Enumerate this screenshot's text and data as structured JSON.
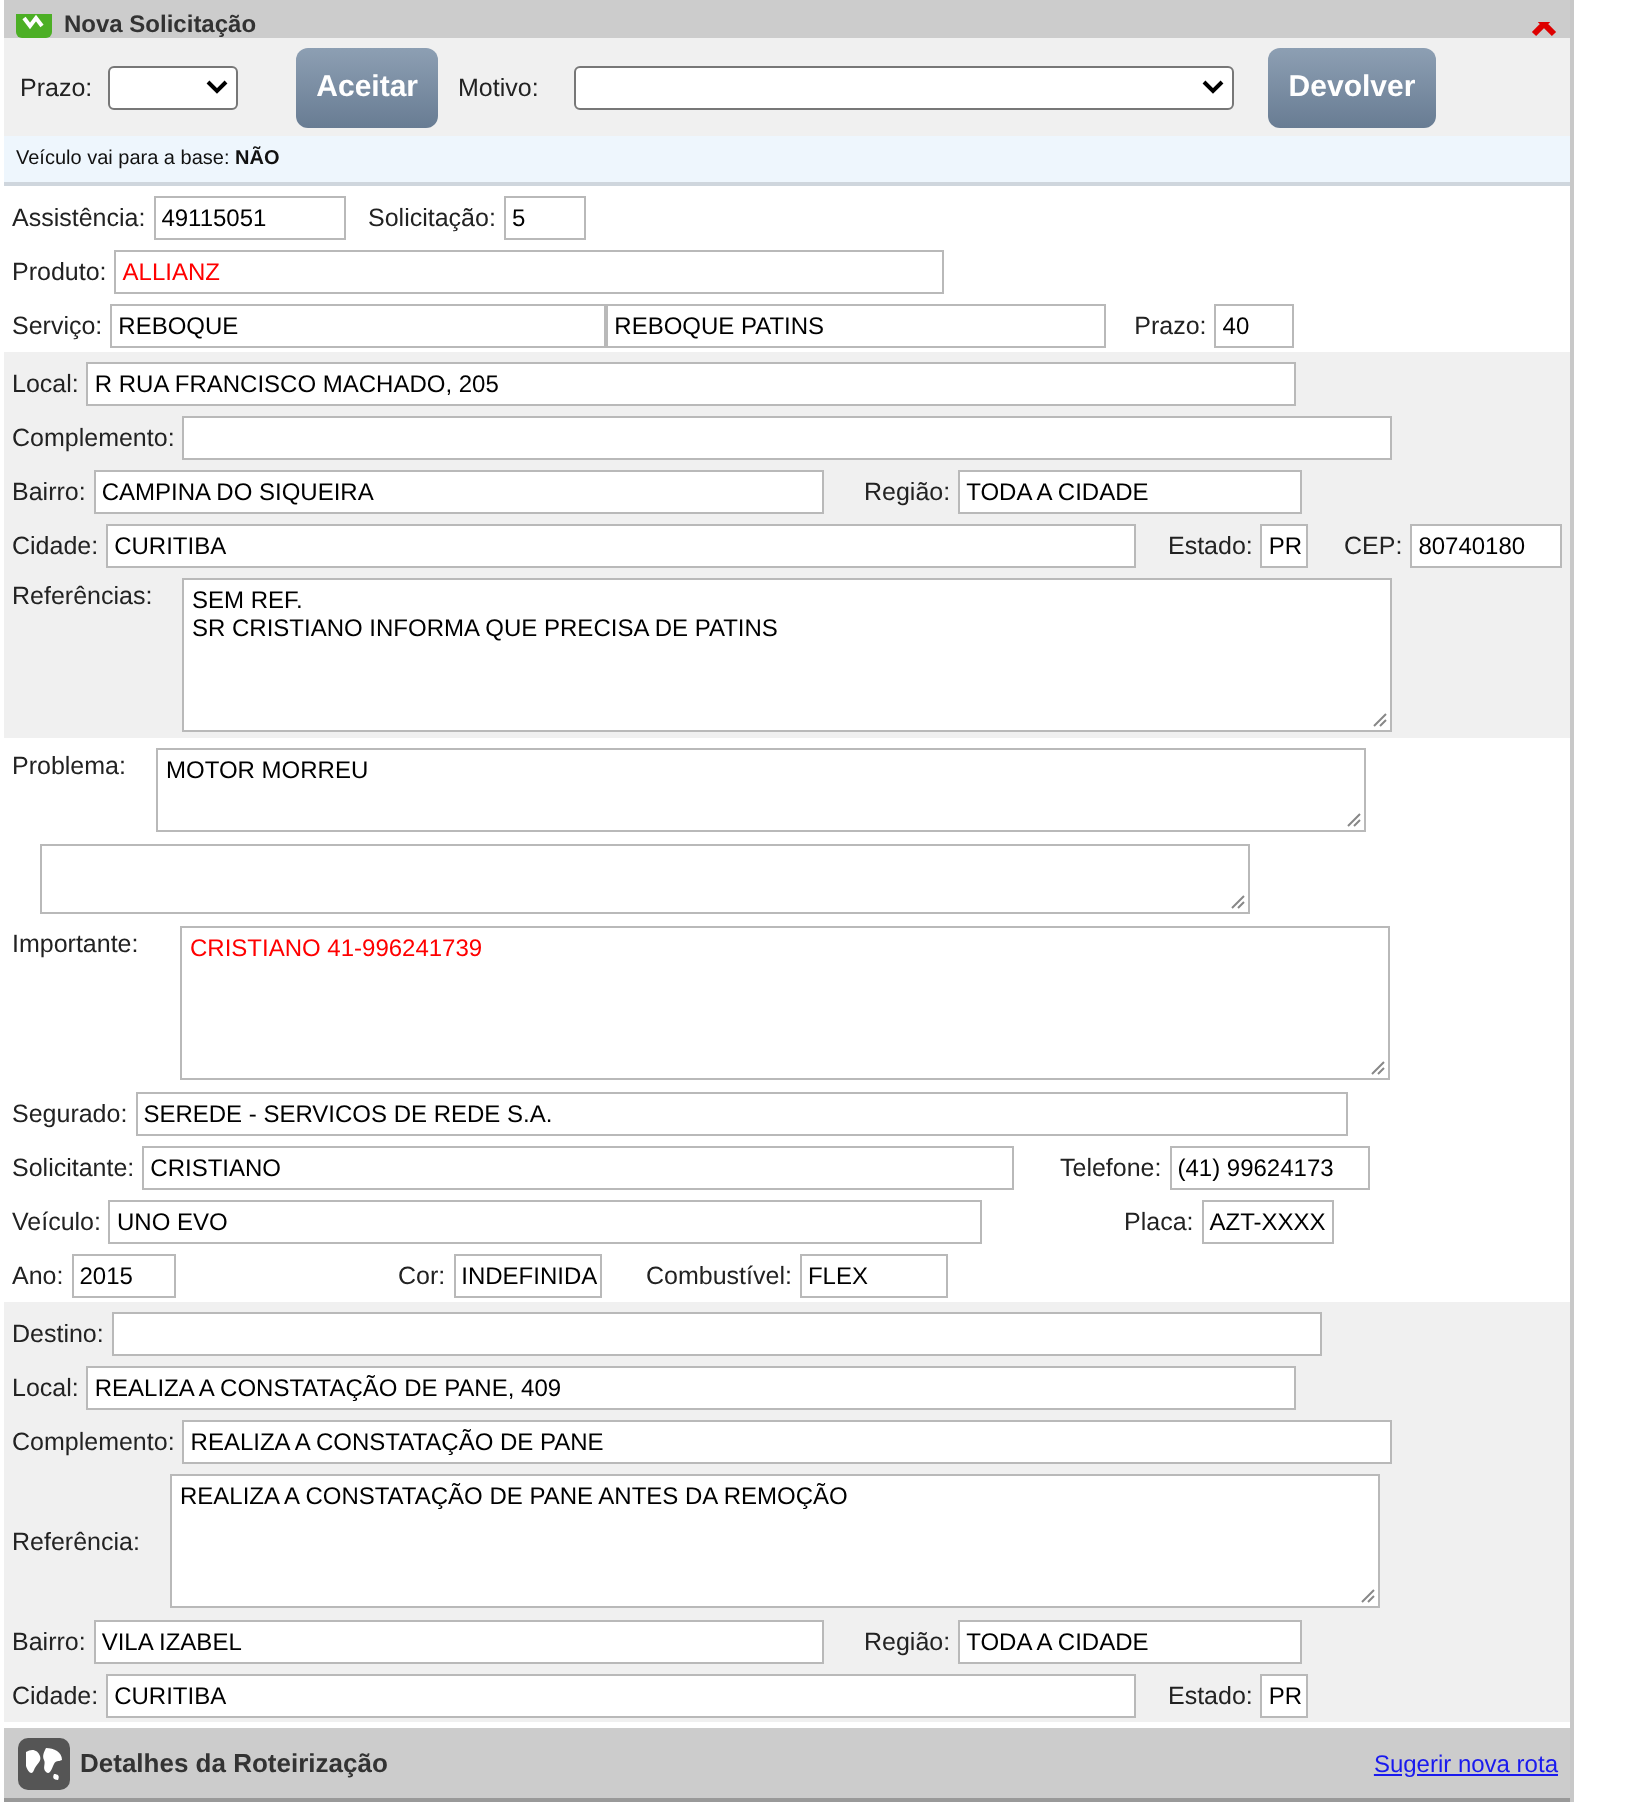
{
  "window": {
    "title": "Nova Solicitação"
  },
  "toolbar": {
    "prazo_label": "Prazo:",
    "accept_button": "Aceitar",
    "motivo_label": "Motivo:",
    "return_button": "Devolver"
  },
  "notice": {
    "label": "Veículo vai para a base:",
    "value": "NÃO"
  },
  "groups": [
    {
      "shaded": false,
      "rows": [
        {
          "kind": "fields",
          "items": [
            {
              "label": "Assistência:",
              "value": "49115051"
            },
            {
              "label": "Solicitação:",
              "value": "5"
            }
          ]
        },
        {
          "kind": "fields",
          "items": [
            {
              "label": "Produto:",
              "value": "ALLIANZ",
              "color": "#ff0000"
            }
          ]
        },
        {
          "kind": "fields",
          "items": [
            {
              "label": "Serviço:",
              "value": "REBOQUE"
            },
            {
              "value": "REBOQUE PATINS"
            },
            {
              "label": "Prazo:",
              "value": "40"
            }
          ]
        }
      ]
    },
    {
      "shaded": true,
      "rows": [
        {
          "kind": "fields",
          "items": [
            {
              "label": "Local:",
              "value": "R RUA FRANCISCO MACHADO, 205"
            }
          ]
        },
        {
          "kind": "fields",
          "items": [
            {
              "label": "Complemento:"
            }
          ]
        },
        {
          "kind": "fields",
          "items": [
            {
              "label": "Bairro:",
              "value": "CAMPINA DO SIQUEIRA"
            },
            {
              "label": "Região:",
              "value": "TODA A CIDADE"
            }
          ]
        },
        {
          "kind": "fields",
          "items": [
            {
              "label": "Cidade:",
              "value": "CURITIBA"
            },
            {
              "label": "Estado:",
              "value": "PR"
            },
            {
              "label": "CEP:",
              "value": "80740180"
            }
          ]
        },
        {
          "kind": "textarea",
          "label": "Referências:",
          "lines": [
            "SEM REF.",
            "SR CRISTIANO INFORMA QUE PRECISA DE PATINS"
          ]
        }
      ]
    },
    {
      "shaded": false,
      "rows": [
        {
          "kind": "textarea",
          "label": "Problema:",
          "lines": [
            "MOTOR MORREU"
          ]
        },
        {
          "kind": "textarea"
        },
        {
          "kind": "textarea",
          "label": "Importante:",
          "lines": [
            "CRISTIANO 41-996241739"
          ],
          "color": "#ff0000"
        },
        {
          "kind": "fields",
          "items": [
            {
              "label": "Segurado:",
              "value": "SEREDE - SERVICOS DE REDE S.A."
            }
          ]
        },
        {
          "kind": "fields",
          "items": [
            {
              "label": "Solicitante:",
              "value": "CRISTIANO"
            },
            {
              "label": "Telefone:",
              "value": "(41) 99624173"
            }
          ]
        },
        {
          "kind": "fields",
          "items": [
            {
              "label": "Veículo:",
              "value": "UNO EVO"
            },
            {
              "label": "Placa:",
              "value": "AZT-XXXX"
            }
          ]
        },
        {
          "kind": "fields",
          "items": [
            {
              "label": "Ano:",
              "value": "2015"
            },
            {
              "label": "Cor:",
              "value": "INDEFINIDA"
            },
            {
              "label": "Combustível:",
              "value": "FLEX"
            }
          ]
        }
      ]
    },
    {
      "shaded": true,
      "rows": [
        {
          "kind": "fields",
          "items": [
            {
              "label": "Destino:"
            }
          ]
        },
        {
          "kind": "fields",
          "items": [
            {
              "label": "Local:",
              "value": "REALIZA A CONSTATAÇÃO DE PANE, 409"
            }
          ]
        },
        {
          "kind": "fields",
          "items": [
            {
              "label": "Complemento:",
              "value": "REALIZA A CONSTATAÇÃO DE PANE"
            }
          ]
        },
        {
          "kind": "textarea",
          "label": "Referência:",
          "lines": [
            "REALIZA A CONSTATAÇÃO DE PANE ANTES DA REMOÇÃO"
          ],
          "centered": true
        },
        {
          "kind": "fields",
          "items": [
            {
              "label": "Bairro:",
              "value": "VILA IZABEL"
            },
            {
              "label": "Região:",
              "value": "TODA A CIDADE"
            }
          ]
        },
        {
          "kind": "fields",
          "items": [
            {
              "label": "Cidade:",
              "value": "CURITIBA"
            },
            {
              "label": "Estado:",
              "value": "PR"
            }
          ]
        }
      ]
    }
  ],
  "footer": {
    "title": "Detalhes da Roteirização",
    "link": "Sugerir nova rota"
  }
}
